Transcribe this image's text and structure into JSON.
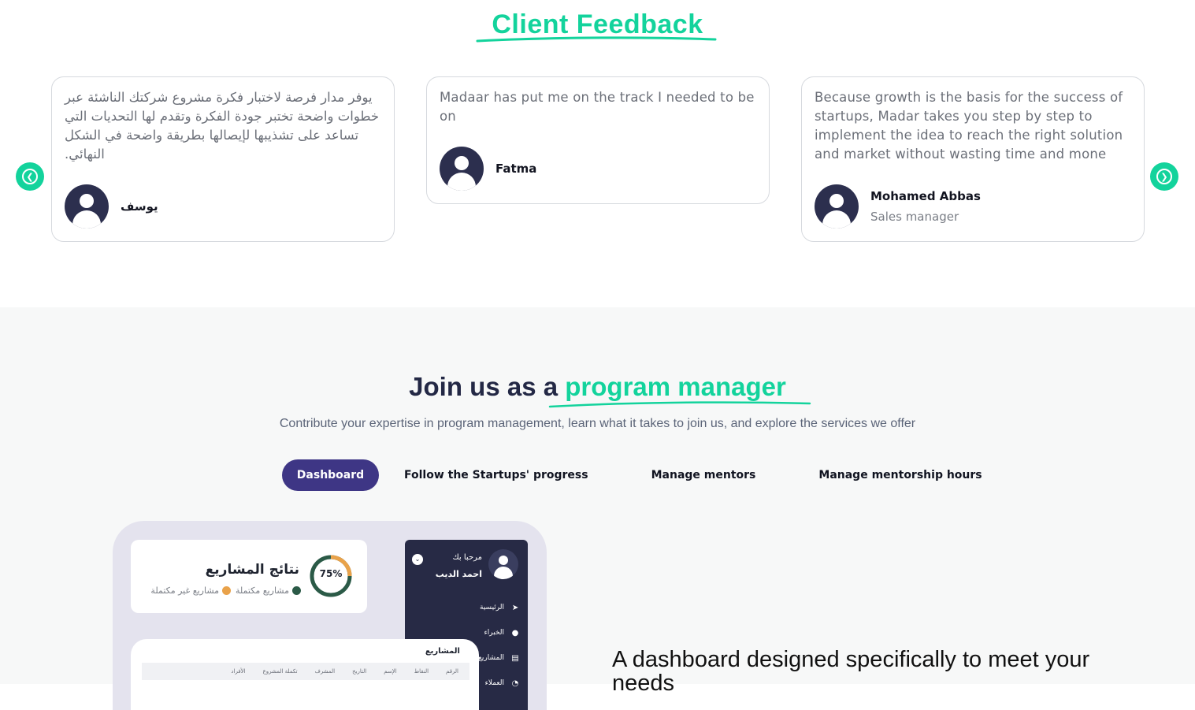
{
  "feedback": {
    "title": "Client Feedback",
    "cards": [
      {
        "quote": "يوفر مدار فرصة لاختبار فكرة مشروع شركتك الناشئة عبر خطوات واضحة تختبر جودة الفكرة وتقدم لها التحديات التي تساعد على تشذيبها لإيصالها بطريقة واضحة في الشكل النهائي.",
        "name": "يوسف",
        "role": ""
      },
      {
        "quote": "Madaar has put me on the track I needed to be on",
        "name": "Fatma",
        "role": ""
      },
      {
        "quote": "Because growth is the basis for the success of startups, Madar takes you step by step to implement the idea to reach the right solution and market without wasting time and mone",
        "name": "Mohamed Abbas",
        "role": "Sales manager"
      }
    ],
    "prev_icon": "chevron-left-circle-icon",
    "next_icon": "chevron-right-circle-icon"
  },
  "join": {
    "title_prefix": "Join us as a ",
    "title_highlight": "program manager",
    "subtitle": "Contribute your expertise in program management, learn what it takes to join us, and explore the services we offer",
    "tabs": [
      "Dashboard",
      "Follow the Startups' progress",
      "Manage mentors",
      "Manage mentorship hours"
    ],
    "active_tab": "Dashboard",
    "feature_title": "A dashboard designed specifically to meet your needs"
  },
  "mockup": {
    "results_title": "نتائج المشاريع",
    "percent": "75%",
    "percent_value": 0.75,
    "legend_complete": "مشاريع مكتملة",
    "legend_incomplete": "مشاريع غير مكتملة",
    "sidebar_greeting": "مرحبا بك",
    "sidebar_user": "احمد الديب",
    "sidebar_items": [
      "الرئيسية",
      "الخبراء",
      "المشاريع",
      "العملاء"
    ],
    "table_title": "المشاريع",
    "table_headers": [
      "الرقم",
      "النقاط",
      "الإسم",
      "التاريخ",
      "المشرف",
      "تكملة المشروع",
      "الأفراد"
    ]
  },
  "colors": {
    "accent": "#13d39c",
    "active_tab": "#3e3685",
    "dark_navy": "#272a45",
    "ring_orange": "#e9a24a",
    "ring_green": "#2b5a47"
  }
}
